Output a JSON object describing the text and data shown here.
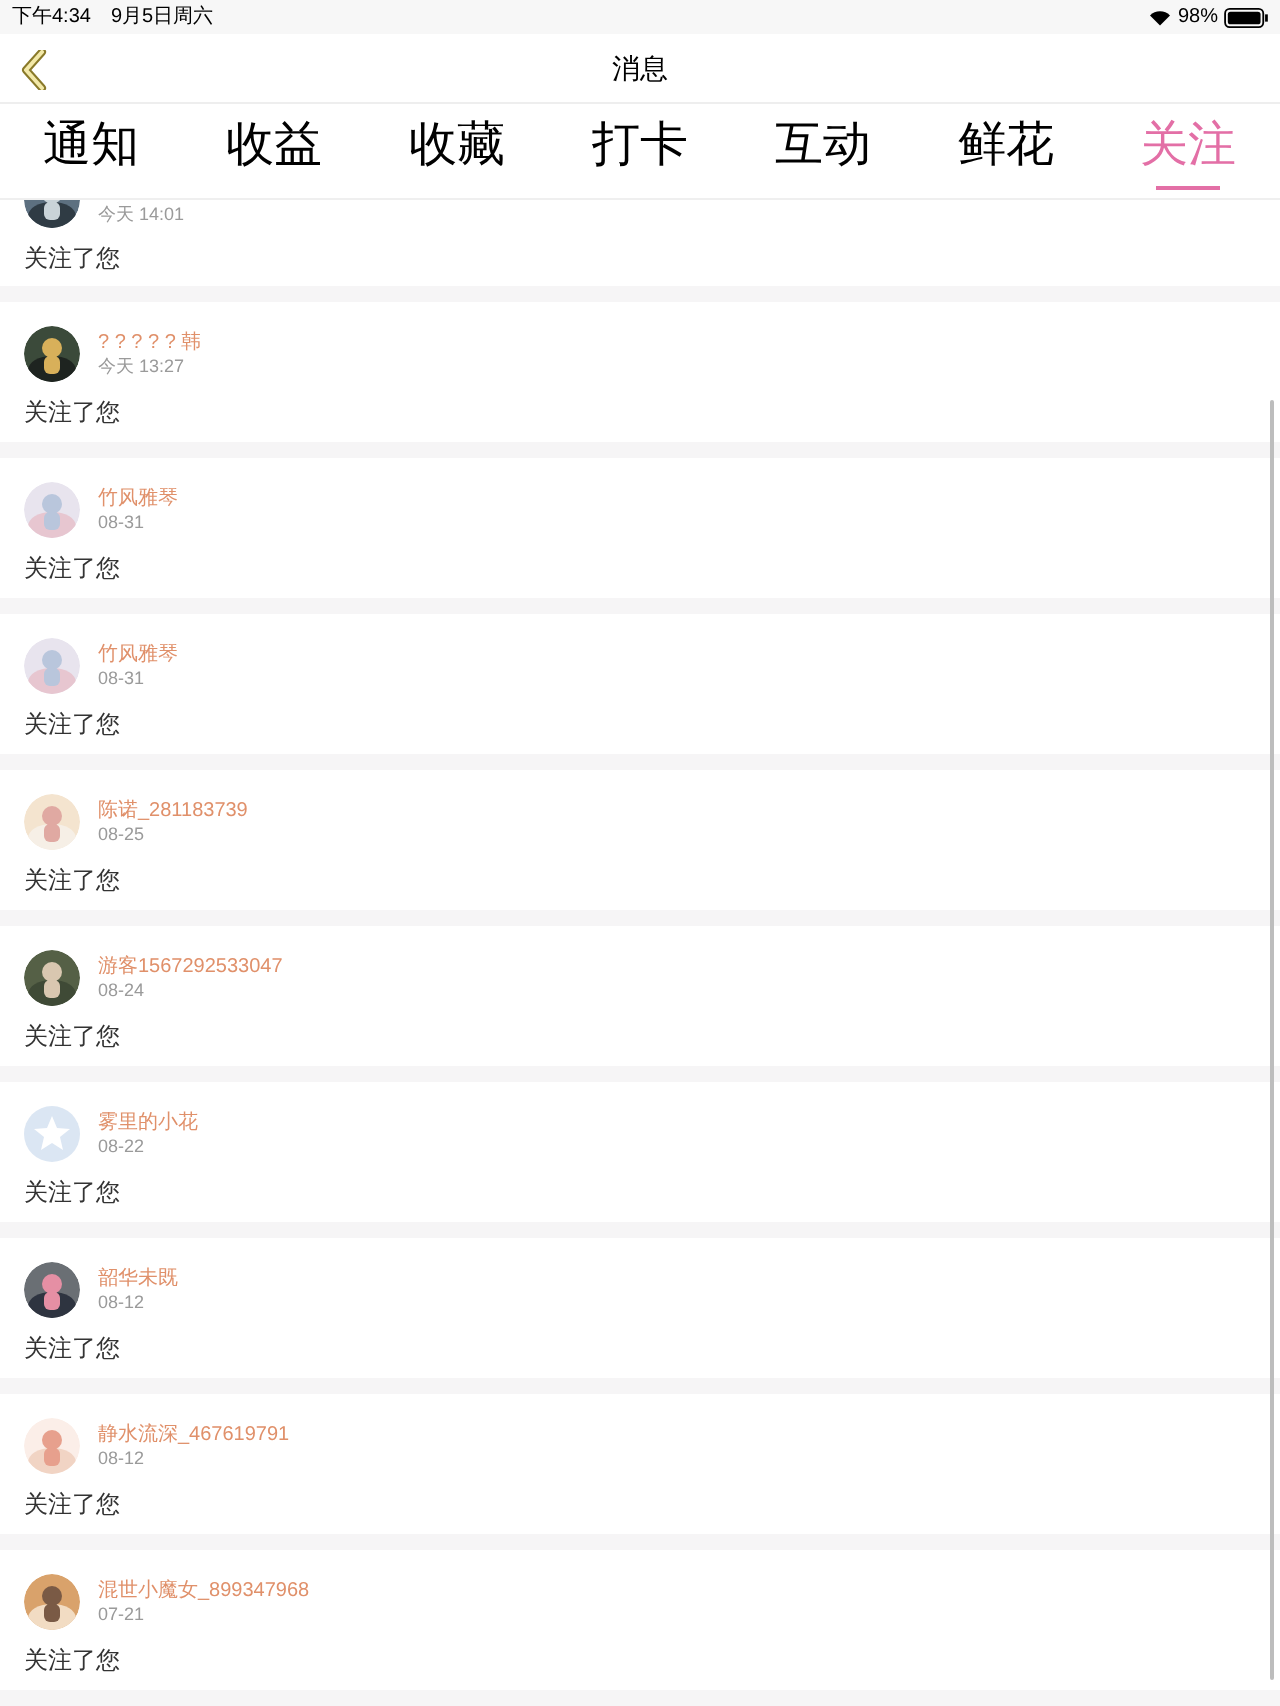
{
  "status_bar": {
    "time": "下午4:34",
    "date": "9月5日周六",
    "battery": "98%"
  },
  "header": {
    "title": "消息"
  },
  "tabs": [
    {
      "label": "通知",
      "selected": false
    },
    {
      "label": "收益",
      "selected": false
    },
    {
      "label": "收藏",
      "selected": false
    },
    {
      "label": "打卡",
      "selected": false
    },
    {
      "label": "互动",
      "selected": false
    },
    {
      "label": "鲜花",
      "selected": false
    },
    {
      "label": "关注",
      "selected": true
    }
  ],
  "messages": [
    {
      "kind": "partial",
      "time": "今天 14:01",
      "text": "关注了您"
    },
    {
      "kind": "full",
      "name": "? ? ? ? ? 韩",
      "time": "今天 13:27",
      "text": "关注了您"
    },
    {
      "kind": "full",
      "name": "竹风雅琴",
      "time": "08-31",
      "text": "关注了您"
    },
    {
      "kind": "full",
      "name": "竹风雅琴",
      "time": "08-31",
      "text": "关注了您"
    },
    {
      "kind": "full",
      "name": "陈诺_281183739",
      "time": "08-25",
      "text": "关注了您"
    },
    {
      "kind": "full",
      "name": "游客1567292533047",
      "time": "08-24",
      "text": "关注了您"
    },
    {
      "kind": "full",
      "avatar": {
        "kind": "default"
      },
      "name": "雾里的小花",
      "time": "08-22",
      "text": "关注了您"
    },
    {
      "kind": "full",
      "name": "韶华未既",
      "time": "08-12",
      "text": "关注了您"
    },
    {
      "kind": "full",
      "name": "静水流深_467619791",
      "time": "08-12",
      "text": "关注了您"
    },
    {
      "kind": "full",
      "name": "混世小魔女_899347968",
      "time": "07-21",
      "text": "关注了您"
    }
  ]
}
